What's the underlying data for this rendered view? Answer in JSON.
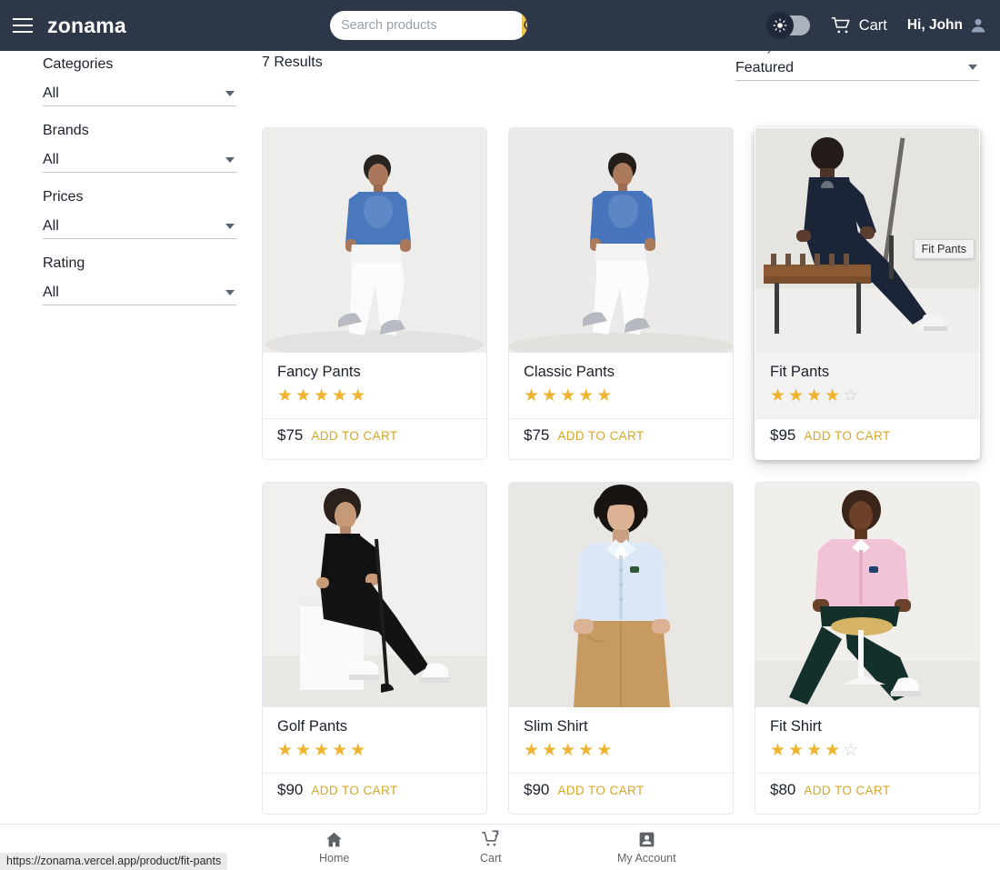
{
  "header": {
    "brand": "zonama",
    "menu_icon": "hamburger-menu-icon",
    "search": {
      "placeholder": "Search products",
      "value": "",
      "button_icon": "search-icon"
    },
    "theme_toggle": {
      "icon": "sun-icon",
      "state": "light"
    },
    "cart": {
      "label": "Cart",
      "icon": "shopping-cart-icon"
    },
    "user": {
      "greeting": "Hi, John",
      "icon": "user-avatar-icon"
    },
    "bg_color": "#2d3748",
    "accent_color": "#ecc44d"
  },
  "sidebar": {
    "filters": [
      {
        "label": "Categories",
        "value": "All",
        "name": "categories"
      },
      {
        "label": "Brands",
        "value": "All",
        "name": "brands"
      },
      {
        "label": "Prices",
        "value": "All",
        "name": "prices"
      },
      {
        "label": "Rating",
        "value": "All",
        "name": "rating"
      }
    ]
  },
  "main": {
    "results_count": "7 Results",
    "sort": {
      "label": "Sort by",
      "value": "Featured"
    }
  },
  "products": [
    {
      "title": "Fancy Pants",
      "price": "$75",
      "rating": 5,
      "max_rating": 5,
      "add_to_cart": "ADD TO CART",
      "hovered": false,
      "image_alt": "model in blue tee and white pants walking"
    },
    {
      "title": "Classic Pants",
      "price": "$75",
      "rating": 5,
      "max_rating": 5,
      "add_to_cart": "ADD TO CART",
      "hovered": false,
      "image_alt": "model in blue tee and white pants walking"
    },
    {
      "title": "Fit Pants",
      "price": "$95",
      "rating": 4,
      "max_rating": 5,
      "add_to_cart": "ADD TO CART",
      "hovered": true,
      "tooltip": "Fit Pants",
      "image_alt": "model in navy outfit sitting on wooden bench"
    },
    {
      "title": "Golf Pants",
      "price": "$90",
      "rating": 5,
      "max_rating": 5,
      "add_to_cart": "ADD TO CART",
      "hovered": false,
      "image_alt": "model in black polo and pants with golf club"
    },
    {
      "title": "Slim Shirt",
      "price": "$90",
      "rating": 5,
      "max_rating": 5,
      "add_to_cart": "ADD TO CART",
      "hovered": false,
      "image_alt": "model in light blue shirt and khaki chinos"
    },
    {
      "title": "Fit Shirt",
      "price": "$80",
      "rating": 4,
      "max_rating": 5,
      "add_to_cart": "ADD TO CART",
      "hovered": false,
      "image_alt": "model in pink shirt and green trousers on stool"
    }
  ],
  "bottom_nav": [
    {
      "label": "Home",
      "icon": "home-icon"
    },
    {
      "label": "Cart",
      "icon": "add-shopping-cart-icon"
    },
    {
      "label": "My Account",
      "icon": "account-box-icon"
    }
  ],
  "status_bar": {
    "url": "https://zonama.vercel.app/product/fit-pants"
  }
}
